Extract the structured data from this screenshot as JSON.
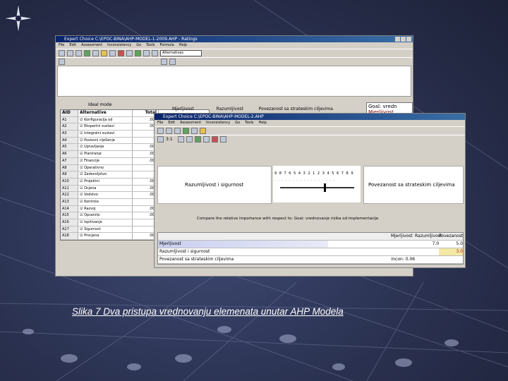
{
  "caption": "Slika 7 Dva pristupa vrednovanju elemenata unutar AHP Modela",
  "back_window": {
    "title": "Expert Choice    C:\\EPOC-BINA\\AHP-MODEL-1-2009.AHP - Ratings",
    "menu": [
      "File",
      "Edit",
      "Assessment",
      "Inconsistency",
      "Go",
      "Tools",
      "Formula",
      "Help"
    ],
    "combo_value": "Alternatives",
    "grid_caption": "Ideal mode",
    "columns": [
      "AID",
      "Alternative",
      "Total"
    ],
    "rows": [
      {
        "aid": "A1",
        "alt": "Konfiguracija od",
        "total": ".000"
      },
      {
        "aid": "A2",
        "alt": "Ekspertni sustavi",
        "total": ".000"
      },
      {
        "aid": "A3",
        "alt": "Integralni sustavi",
        "total": "0"
      },
      {
        "aid": "A4",
        "alt": "Poslovni rijeSenje",
        "total": "0"
      },
      {
        "aid": "A5",
        "alt": "Upravljanje",
        "total": ".000"
      },
      {
        "aid": "A6",
        "alt": "Planiranje",
        "total": ".000"
      },
      {
        "aid": "A7",
        "alt": "Financije",
        "total": ".000"
      },
      {
        "aid": "A8",
        "alt": "Operativno",
        "total": "0"
      },
      {
        "aid": "A9",
        "alt": "Zadovoljstvo",
        "total": "0"
      },
      {
        "aid": "A10",
        "alt": "Projektni",
        "total": ".000"
      },
      {
        "aid": "A11",
        "alt": "Ocjena",
        "total": ".000"
      },
      {
        "aid": "A12",
        "alt": "Vodstvo",
        "total": ".000"
      },
      {
        "aid": "A13",
        "alt": "Kontrola",
        "total": "0"
      },
      {
        "aid": "A14",
        "alt": "Razvoj",
        "total": ".000"
      },
      {
        "aid": "A15",
        "alt": "Opcenito",
        "total": ".000"
      },
      {
        "aid": "A16",
        "alt": "Ispitivanje",
        "total": "0"
      },
      {
        "aid": "A17",
        "alt": "Sigurnost",
        "total": "0"
      },
      {
        "aid": "A18",
        "alt": "Procjena",
        "total": ".000"
      }
    ],
    "col_headers_right": [
      "Mjerljivost",
      "Razumljivost",
      "Povezanost sa strateskim ciljevima"
    ],
    "goal_panel": [
      "Goal: vredn",
      "Mjerljivost"
    ]
  },
  "front_window": {
    "title": "Expert Choice    C:\\EPOC-BINA\\AHP-MODEL-2.AHP",
    "menu": [
      "File",
      "Edit",
      "Assessment",
      "Inconsistency",
      "Go",
      "Tools",
      "Help"
    ],
    "zoom": "3:1",
    "left_label": "Razumljivost i sigurnost",
    "right_label": "Povezanost sa strateskim ciljevima",
    "scale_top": "9 8 7 6 5 4 3 2 1 2 3 4 5 6 7 8 9",
    "compare_text": "Compare the relative importance with respect to: Goal: vrednovanje rizika od implementacije",
    "matrix_header": [
      "Mjerljivost",
      "Razumljivost",
      "Povezanost"
    ],
    "matrix_rows": [
      {
        "name": "Mjerljivost",
        "v1": "",
        "v2": "7.0",
        "v3": "5.0"
      },
      {
        "name": "Razumljivost i sigurnost",
        "v1": "",
        "v2": "",
        "v3": "3.0"
      },
      {
        "name": "Povezanost sa strateskim ciljevima",
        "v1": "",
        "v2": "",
        "v3": "Incon: 0.06"
      }
    ]
  }
}
